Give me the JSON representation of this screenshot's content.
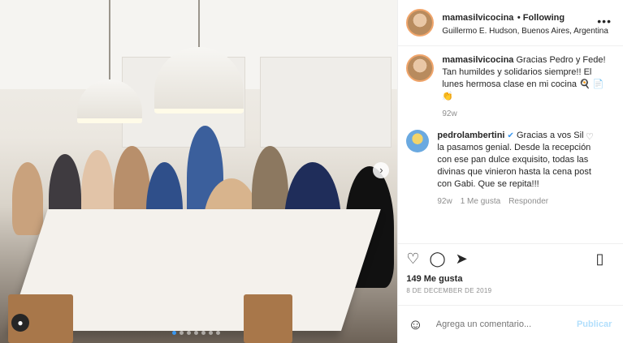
{
  "post": {
    "account": "mamasilvicocina",
    "following": "• Following",
    "location": "Guillermo E. Hudson, Buenos Aires, Argentina",
    "more_icon": "more-options-icon",
    "comments": [
      {
        "user": "mamasilvicocina",
        "text": "Gracias Pedro y Fede! Tan humildes y solidarios siempre!! El lunes hermosa clase en mi cocina 🍳 📄 👏",
        "age": "92w"
      },
      {
        "user": "pedrolambertini",
        "verified": "✔",
        "text": "Gracias a vos Sil la pasamos genial. Desde la recepción con ese pan dulce exquisito, todas las divinas que vinieron hasta la cena post con Gabi. Que se repita!!!",
        "age": "92w",
        "likes": "1 Me gusta",
        "reply": "Responder"
      }
    ],
    "likes": "149 Me gusta",
    "date": "8 DE DECEMBER DE 2019",
    "add_comment_placeholder": "Agrega un comentario...",
    "publish": "Publicar"
  },
  "icons": [
    "heart-icon",
    "comment-icon",
    "share-icon",
    "bookmark-icon",
    "emoji-icon",
    "user-tag-icon",
    "next-arrow-icon"
  ],
  "colors": {
    "accent": "#3897f0",
    "muted": "#8e8e8e",
    "text": "#262626",
    "publish": "#b2dffc"
  }
}
